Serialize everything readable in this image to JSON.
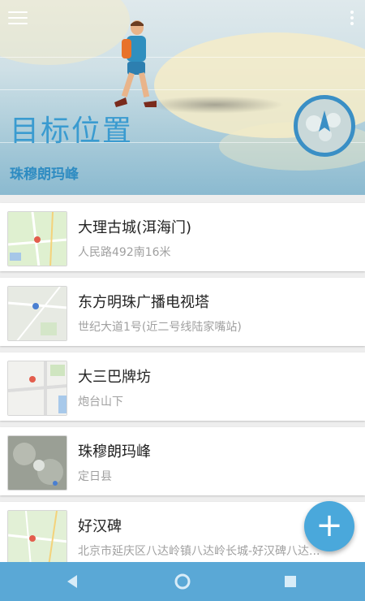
{
  "header": {
    "title": "目标位置",
    "subtitle": "珠穆朗玛峰"
  },
  "places": [
    {
      "name": "大理古城(洱海门)",
      "address": "人民路492南16米",
      "thumb": "green-map"
    },
    {
      "name": "东方明珠广播电视塔",
      "address": "世纪大道1号(近二号线陆家嘴站)",
      "thumb": "grey-map"
    },
    {
      "name": "大三巴牌坊",
      "address": "炮台山下",
      "thumb": "street-map"
    },
    {
      "name": "珠穆朗玛峰",
      "address": "定日县",
      "thumb": "satellite-map"
    },
    {
      "name": "好汉碑",
      "address": "北京市延庆区八达岭镇八达岭长城-好汉碑八达...",
      "thumb": "green-map"
    }
  ],
  "fab": {
    "symbol": "+"
  },
  "colors": {
    "accent": "#3a9bd0",
    "navbar": "#5aa8d6",
    "fab": "#4aa8db"
  }
}
